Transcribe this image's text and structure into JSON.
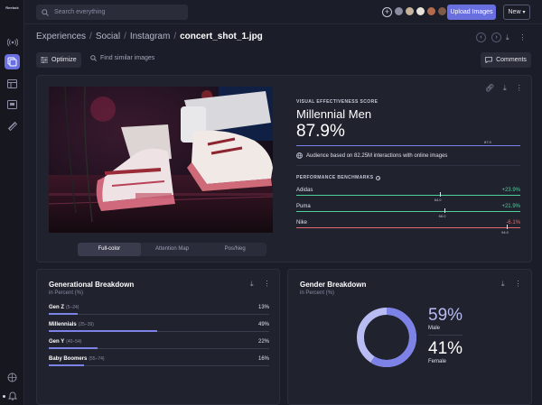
{
  "app": {
    "logo_text": "Reebok"
  },
  "topbar": {
    "search_placeholder": "Search everything",
    "upload_label": "Upload Images",
    "new_label": "New",
    "avatars": [
      "#8a8ca0",
      "#c7b39c",
      "#e7e3dc",
      "#b26b4c",
      "#7f5a46",
      "#c9a08a",
      "#d68f8f"
    ]
  },
  "breadcrumb": {
    "items": [
      "Experiences",
      "Social",
      "Instagram"
    ],
    "current": "concert_shot_1.jpg"
  },
  "toolbar": {
    "optimize_label": "Optimize",
    "find_similar_label": "Find similar images",
    "comments_label": "Comments"
  },
  "score": {
    "section_label": "VISUAL EFFECTIVENESS SCORE",
    "audience": "Millennial Men",
    "value": "87.9%",
    "marker_label": "87.9",
    "fraction": 0.879,
    "audience_note": "Audience based on 82.25M interactions with online images"
  },
  "view_tabs": {
    "items": [
      "Full-color",
      "Attention Map",
      "Pos/Neg"
    ],
    "active": 0
  },
  "benchmarks": {
    "label": "PERFORMANCE BENCHMARKS",
    "items": [
      {
        "name": "Adidas",
        "delta": "+23.9%",
        "marker": "64.0",
        "color": "#4fcf9b",
        "fraction": 0.64
      },
      {
        "name": "Puma",
        "delta": "+21.9%",
        "marker": "66.0",
        "color": "#4fcf9b",
        "fraction": 0.66
      },
      {
        "name": "Nike",
        "delta": "-6.1%",
        "marker": "94.0",
        "color": "#e06a6f",
        "fraction": 0.94
      }
    ]
  },
  "generational": {
    "title": "Generational Breakdown",
    "subtitle": "in Percent (%)",
    "rows": [
      {
        "name": "Gen Z",
        "range": "(5–24)",
        "value": "13%",
        "fraction": 0.13
      },
      {
        "name": "Millennials",
        "range": "(25–39)",
        "value": "49%",
        "fraction": 0.49
      },
      {
        "name": "Gen Y",
        "range": "(40–54)",
        "value": "22%",
        "fraction": 0.22
      },
      {
        "name": "Baby Boomers",
        "range": "(55–74)",
        "value": "16%",
        "fraction": 0.16
      }
    ]
  },
  "gender": {
    "title": "Gender Breakdown",
    "subtitle": "in Percent (%)",
    "male_value": "59%",
    "male_label": "Male",
    "male_fraction": 0.59,
    "female_value": "41%",
    "female_label": "Female"
  },
  "colors": {
    "accent": "#6a6fe0",
    "positive": "#4fcf9b",
    "negative": "#e06a6f",
    "donut_main": "#7d82e6",
    "donut_rest": "#b9bcf2"
  }
}
